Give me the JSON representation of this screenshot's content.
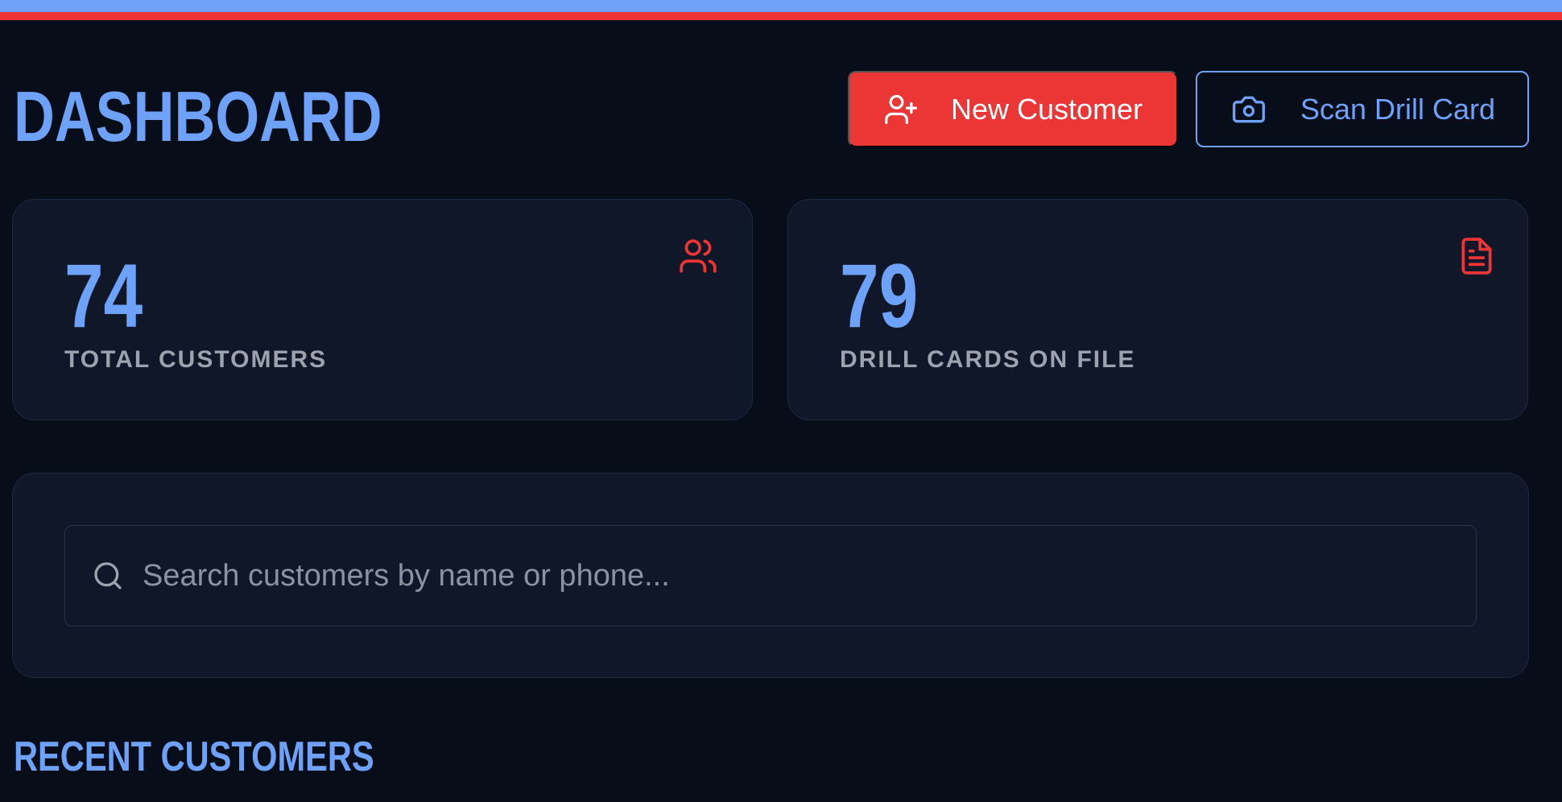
{
  "header": {
    "title": "DASHBOARD",
    "new_customer_label": "New Customer",
    "scan_drill_card_label": "Scan Drill Card"
  },
  "stats": {
    "total_customers": {
      "value": "74",
      "label": "TOTAL CUSTOMERS",
      "icon": "users-icon"
    },
    "drill_cards": {
      "value": "79",
      "label": "DRILL CARDS ON FILE",
      "icon": "file-text-icon"
    }
  },
  "search": {
    "placeholder": "Search customers by name or phone...",
    "value": "",
    "icon": "search-icon"
  },
  "recent": {
    "title": "RECENT CUSTOMERS"
  },
  "colors": {
    "background": "#080d1a",
    "card": "#0f1728",
    "accent_blue": "#6ea1f8",
    "accent_red": "#ec3535",
    "muted_text": "#9ca3af"
  }
}
